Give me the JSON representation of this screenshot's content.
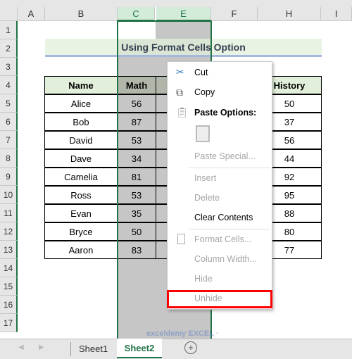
{
  "columns": [
    "A",
    "B",
    "C",
    "E",
    "F",
    "H",
    "I"
  ],
  "rows": [
    "1",
    "2",
    "3",
    "4",
    "5",
    "6",
    "7",
    "8",
    "9",
    "10",
    "11",
    "12",
    "13",
    "14",
    "15",
    "16",
    "17"
  ],
  "title": "Using Format Cells Option",
  "table": {
    "headers": [
      "Name",
      "Math",
      "History"
    ],
    "rows": [
      [
        "Alice",
        "56",
        "50"
      ],
      [
        "Bob",
        "87",
        "37"
      ],
      [
        "David",
        "53",
        "56"
      ],
      [
        "Dave",
        "34",
        "44"
      ],
      [
        "Camelia",
        "81",
        "92"
      ],
      [
        "Ross",
        "53",
        "95"
      ],
      [
        "Evan",
        "35",
        "88"
      ],
      [
        "Bryce",
        "50",
        "80"
      ],
      [
        "Aaron",
        "83",
        "77"
      ]
    ]
  },
  "menu": {
    "cut": "Cut",
    "copy": "Copy",
    "paste_options": "Paste Options:",
    "paste_special": "Paste Special...",
    "insert": "Insert",
    "delete": "Delete",
    "clear_contents": "Clear Contents",
    "format_cells": "Format Cells...",
    "column_width": "Column Width...",
    "hide": "Hide",
    "unhide": "Unhide"
  },
  "tabs": [
    "Sheet1",
    "Sheet2"
  ],
  "active_tab": "Sheet2",
  "watermark": "exceldemy EXCEL · DATA · BI",
  "colors": {
    "accent": "#217346",
    "highlight": "#ff0000",
    "header_fill": "#e2efda"
  }
}
